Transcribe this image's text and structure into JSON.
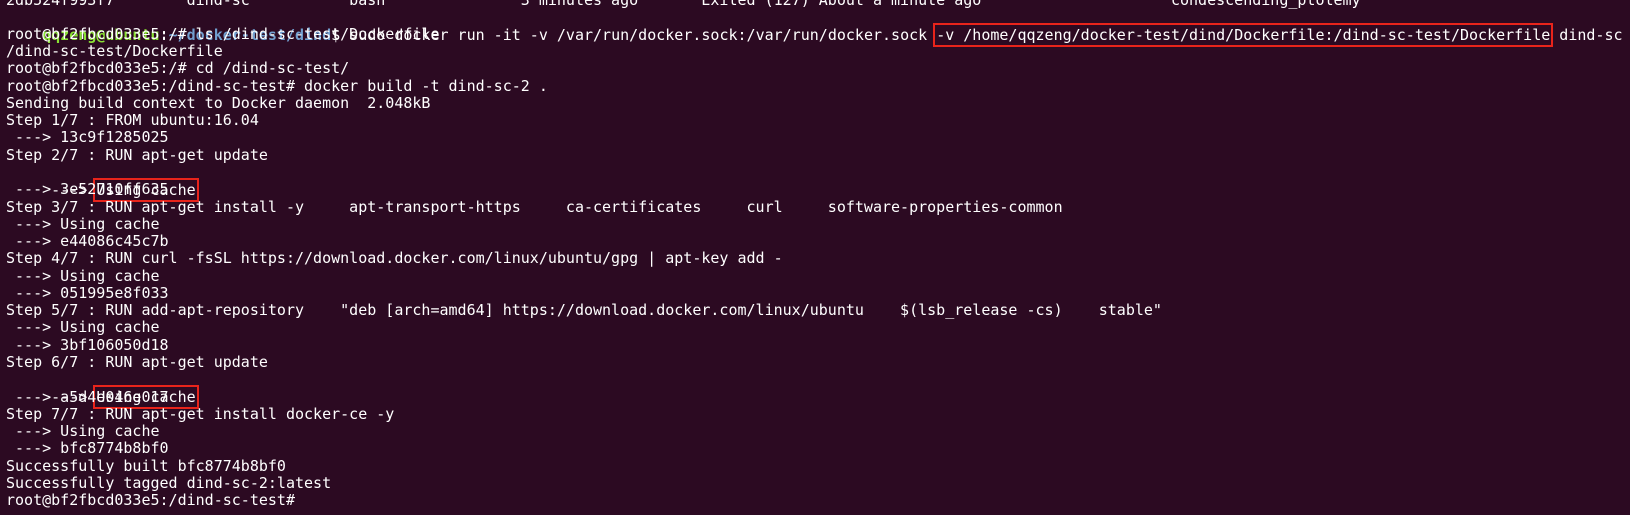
{
  "terminal": {
    "colors": {
      "background": "#2c0a22",
      "text": "#ffffff",
      "prompt_user": "#8ae234",
      "prompt_path": "#729fcf",
      "highlight_box": "#e8241b"
    },
    "top_partial_line": "2db524f993f7        dind-sc          \"bash\"              3 minutes ago       Exited (127) About a minute ago                     condescending_ptolemy",
    "host_prompt": {
      "user_host": "qqzeng@ubuntu",
      "separator": ":",
      "path": "~/docker-test/dind",
      "dollar": "$ ",
      "command_before": "sudo docker run -it -v /var/run/docker.sock:/var/run/docker.sock ",
      "command_highlight": "-v /home/qqzeng/docker-test/dind/Dockerfile:/dind-sc-test/Dockerfile",
      "command_after": " dind-sc bash"
    },
    "lines": [
      "root@bf2fbcd033e5:/# ls /dind-sc-test/Dockerfile",
      "/dind-sc-test/Dockerfile",
      "root@bf2fbcd033e5:/# cd /dind-sc-test/",
      "root@bf2fbcd033e5:/dind-sc-test# docker build -t dind-sc-2 .",
      "Sending build context to Docker daemon  2.048kB",
      "Step 1/7 : FROM ubuntu:16.04",
      " ---> 13c9f1285025",
      "Step 2/7 : RUN apt-get update",
      "",
      " ---> 3e52710ff635",
      "Step 3/7 : RUN apt-get install -y     apt-transport-https     ca-certificates     curl     software-properties-common",
      " ---> Using cache",
      " ---> e44086c45c7b",
      "Step 4/7 : RUN curl -fsSL https://download.docker.com/linux/ubuntu/gpg | apt-key add -",
      " ---> Using cache",
      " ---> 051995e8f033",
      "Step 5/7 : RUN add-apt-repository    \"deb [arch=amd64] https://download.docker.com/linux/ubuntu    $(lsb_release -cs)    stable\"",
      " ---> Using cache",
      " ---> 3bf106050d18",
      "Step 6/7 : RUN apt-get update",
      "",
      " ---> a5d4e046e017",
      "Step 7/7 : RUN apt-get install docker-ce -y",
      " ---> Using cache",
      " ---> bfc8774b8bf0",
      "Successfully built bfc8774b8bf0",
      "Successfully tagged dind-sc-2:latest",
      "root@bf2fbcd033e5:/dind-sc-test#"
    ],
    "highlighted_cache_lines": {
      "step2": {
        "arrow": " ---> ",
        "text": "Using cache"
      },
      "step6": {
        "arrow": " ---> ",
        "text": "Using cache"
      }
    }
  }
}
